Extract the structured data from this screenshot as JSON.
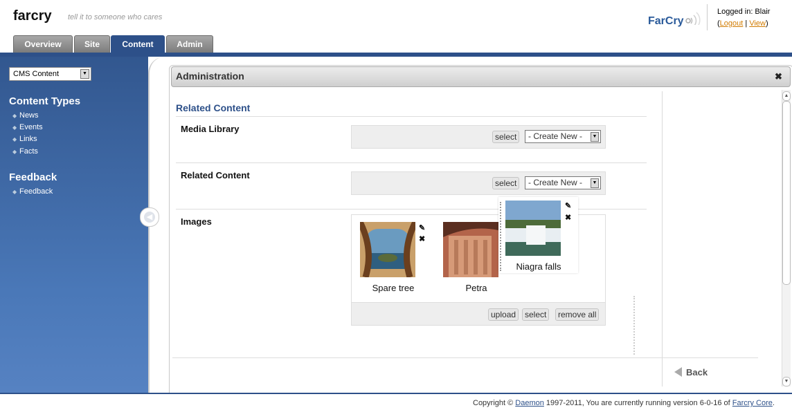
{
  "header": {
    "brand": "farcry",
    "tagline": "tell it to someone who cares",
    "logo_text": "FarCry",
    "logged_in_label": "Logged in: Blair",
    "logout_label": "Logout",
    "view_label": "View"
  },
  "tabs": [
    {
      "label": "Overview"
    },
    {
      "label": "Site"
    },
    {
      "label": "Content"
    },
    {
      "label": "Admin"
    }
  ],
  "sidebar": {
    "select_value": "CMS Content",
    "section1_title": "Content Types",
    "section1_items": [
      "News",
      "Events",
      "Links",
      "Facts"
    ],
    "section2_title": "Feedback",
    "section2_items": [
      "Feedback"
    ]
  },
  "panel": {
    "title": "Administration",
    "section_title": "Related Content",
    "media_label": "Media Library",
    "related_label": "Related Content",
    "images_label": "Images",
    "select_label": "select",
    "create_new_label": "- Create New -",
    "upload_label": "upload",
    "remove_all_label": "remove all",
    "images": [
      {
        "caption": "Spare tree"
      },
      {
        "caption": "Petra"
      },
      {
        "caption": "Niagra falls"
      }
    ],
    "back_label": "Back"
  },
  "footer": {
    "pre": "Copyright © ",
    "daemon": "Daemon",
    "mid": " 1997-2011, You are currently running version 6-0-16 of ",
    "core": "Farcry Core",
    "post": "."
  },
  "colors": {
    "accent": "#2d5089",
    "link": "#d17b00"
  }
}
